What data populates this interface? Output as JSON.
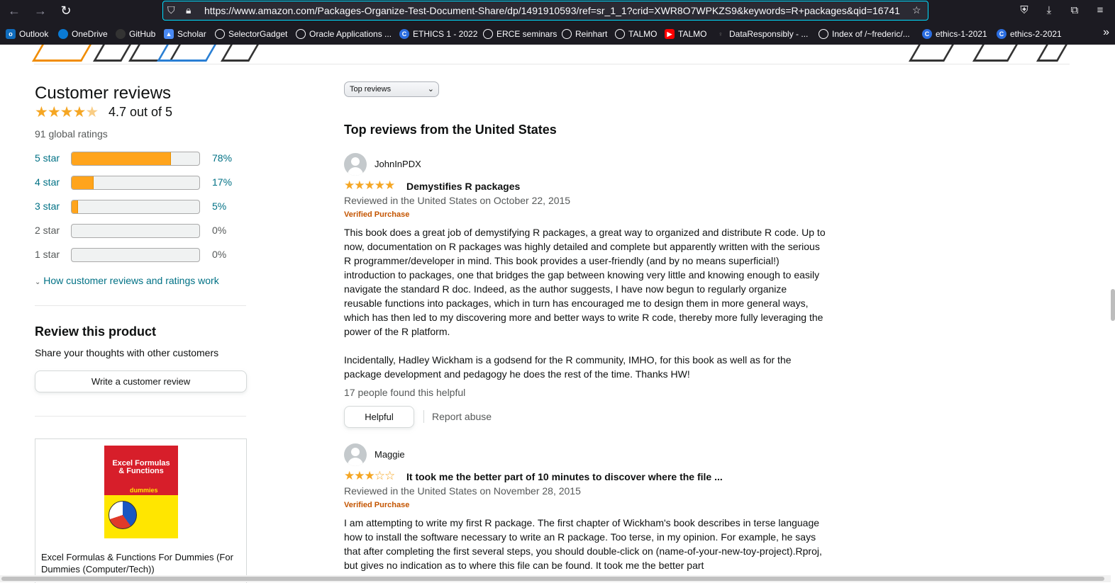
{
  "browser": {
    "url": "https://www.amazon.com/Packages-Organize-Test-Document-Share/dp/1491910593/ref=sr_1_1?crid=XWR8O7WPKZS9&keywords=R+packages&qid=16741",
    "bookmarks": [
      {
        "label": "Outlook",
        "icon": "outlook-icon"
      },
      {
        "label": "OneDrive",
        "icon": "onedrive-icon"
      },
      {
        "label": "GitHub",
        "icon": "github-icon"
      },
      {
        "label": "Scholar",
        "icon": "scholar-icon"
      },
      {
        "label": "SelectorGadget",
        "icon": "globe-icon"
      },
      {
        "label": "Oracle Applications ...",
        "icon": "globe-icon"
      },
      {
        "label": "ETHICS 1 - 2022",
        "icon": "canvas-icon"
      },
      {
        "label": "ERCE seminars",
        "icon": "globe-icon"
      },
      {
        "label": "Reinhart",
        "icon": "globe-icon"
      },
      {
        "label": "TALMO",
        "icon": "globe-icon"
      },
      {
        "label": "TALMO",
        "icon": "youtube-icon"
      },
      {
        "label": "DataResponsibly - ...",
        "icon": "bulb-icon"
      },
      {
        "label": "Index of /~frederic/...",
        "icon": "globe-icon"
      },
      {
        "label": "ethics-1-2021",
        "icon": "canvas-icon"
      },
      {
        "label": "ethics-2-2021",
        "icon": "canvas-icon"
      }
    ]
  },
  "summary": {
    "title": "Customer reviews",
    "average": "4.7 out of 5",
    "total": "91 global ratings",
    "histogram": [
      {
        "label": "5 star",
        "pct": "78%",
        "fraction": 0.78,
        "linked": true
      },
      {
        "label": "4 star",
        "pct": "17%",
        "fraction": 0.17,
        "linked": true
      },
      {
        "label": "3 star",
        "pct": "5%",
        "fraction": 0.05,
        "linked": true
      },
      {
        "label": "2 star",
        "pct": "0%",
        "fraction": 0,
        "linked": false
      },
      {
        "label": "1 star",
        "pct": "0%",
        "fraction": 0,
        "linked": false
      }
    ],
    "how_link": "How customer reviews and ratings work"
  },
  "review_product": {
    "title": "Review this product",
    "subtitle": "Share your thoughts with other customers",
    "button": "Write a customer review"
  },
  "ad": {
    "cover_title": "Excel Formulas & Functions",
    "cover_brand": "dummies",
    "title": "Excel Formulas & Functions For Dummies (For Dummies (Computer/Tech))"
  },
  "reviews_section": {
    "sort_selected": "Top reviews",
    "title": "Top reviews from the United States"
  },
  "reviews": [
    {
      "name": "JohnInPDX",
      "rating": 5,
      "title": "Demystifies R packages",
      "date": "Reviewed in the United States on October 22, 2015",
      "verified": "Verified Purchase",
      "body1": "This book does a great job of demystifying R packages, a great way to organized and distribute R code. Up to now, documentation on R packages was highly detailed and complete but apparently written with the serious R programmer/developer in mind. This book provides a user-friendly (and by no means superficial!) introduction to packages, one that bridges the gap between knowing very little and knowing enough to easily navigate the standard R doc. Indeed, as the author suggests, I have now begun to regularly organize reusable functions into packages, which in turn has encouraged me to design them in more general ways, which has then led to my discovering more and better ways to write R code, thereby more fully leveraging the power of the R platform.",
      "body2": "Incidentally, Hadley Wickham is a godsend for the R community, IMHO, for this book as well as for the package development and pedagogy he does the rest of the time. Thanks HW!",
      "helpful_count": "17 people found this helpful",
      "helpful_btn": "Helpful",
      "report": "Report abuse"
    },
    {
      "name": "Maggie",
      "rating": 3,
      "title": "It took me the better part of 10 minutes to discover where the file ...",
      "date": "Reviewed in the United States on November 28, 2015",
      "verified": "Verified Purchase",
      "body1": "I am attempting to write my first R package. The first chapter of Wickham's book describes in terse language how to install the software necessary to write an R package. Too terse, in my opinion. For example, he says that after completing the first several steps, you should double-click on (name-of-your-new-toy-project).Rproj, but gives no indication as to where this file can be found. It took me the better part"
    }
  ],
  "colors": {
    "star": "#f5a623",
    "bar_fill": "#ffa41c",
    "link": "#007185",
    "verified": "#c45500",
    "chrome_bg": "#1c1b22",
    "url_focus": "#00ddff"
  }
}
